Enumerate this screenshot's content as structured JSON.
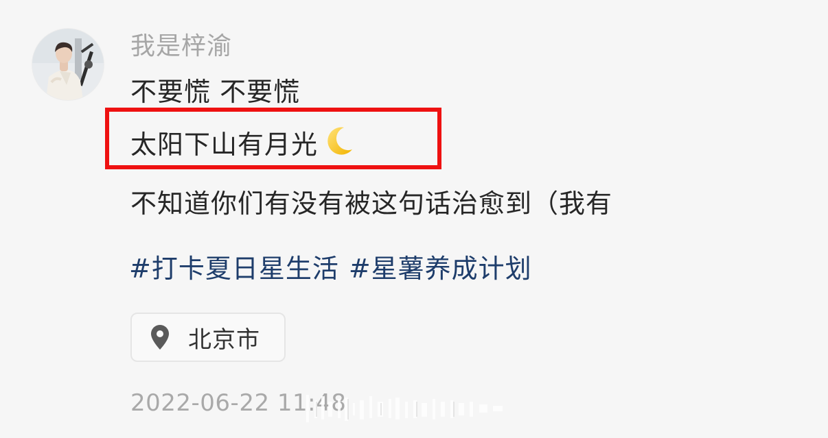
{
  "post": {
    "username": "我是梓渝",
    "lines": [
      "不要慌 不要慌",
      "太阳下山有月光",
      "不知道你们有没有被这句话治愈到（我有"
    ],
    "moon_emoji_icon": "crescent-moon-icon",
    "hashtags": [
      "#打卡夏日星生活",
      "#星薯养成计划"
    ],
    "location": {
      "icon": "location-pin-icon",
      "label": "北京市"
    },
    "timestamp": "2022-06-22 11:48"
  },
  "colors": {
    "background": "#f6f6f6",
    "username": "#a6a6a6",
    "body_text": "#262626",
    "hashtag": "#1e3d6b",
    "highlight_box": "#ee1111",
    "timestamp": "#a9a9a9"
  }
}
